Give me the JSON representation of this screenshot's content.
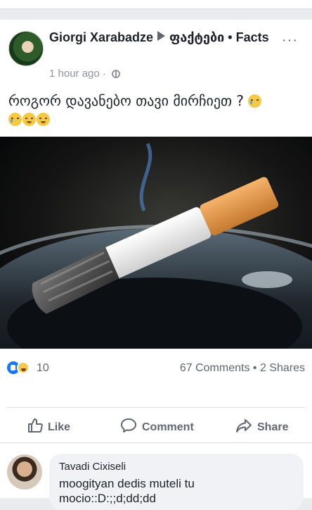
{
  "post": {
    "author": "Giorgi Xarabadze",
    "group": "ფაქტები • Facts",
    "time": "1 hour ago",
    "separator": "·",
    "more": "···",
    "status_text": "როგორ დავანებო თავი მირჩიეთ ?",
    "image_subject": "cigarette",
    "reactions_count": "10",
    "comments": "67 Comments",
    "shares": "2 Shares",
    "stats_separator": "•"
  },
  "actions": {
    "like": "Like",
    "comment": "Comment",
    "share": "Share"
  },
  "comment": {
    "author": "Tavadi Cixiseli",
    "text": "moogityan dedis muteli tu mocio::D:;;d;dd;dd"
  },
  "colors": {
    "accent": "#1877f2",
    "muted": "#606770",
    "background": "#e9ebee"
  }
}
